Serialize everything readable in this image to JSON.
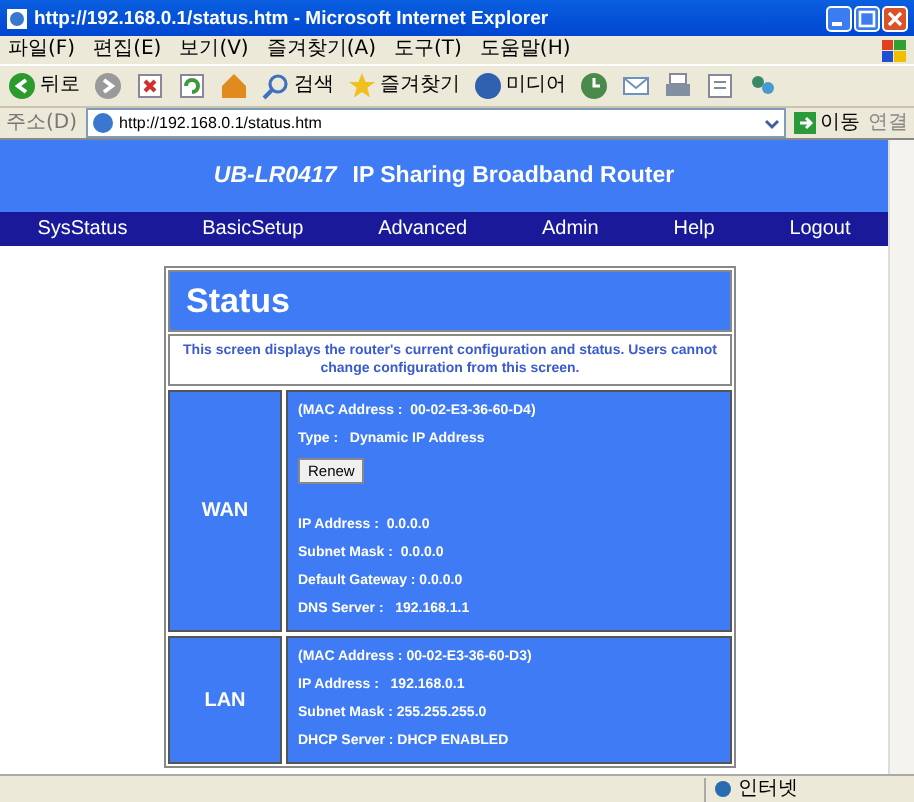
{
  "window": {
    "title": "http://192.168.0.1/status.htm - Microsoft Internet Explorer"
  },
  "menu": [
    "파일(F)",
    "편집(E)",
    "보기(V)",
    "즐겨찾기(A)",
    "도구(T)",
    "도움말(H)"
  ],
  "toolbar": [
    {
      "kind": "back",
      "label": "뒤로"
    },
    {
      "kind": "forward"
    },
    {
      "kind": "stop"
    },
    {
      "kind": "refresh"
    },
    {
      "kind": "home"
    },
    {
      "kind": "search",
      "label": "검색"
    },
    {
      "kind": "favorites",
      "label": "즐겨찾기"
    },
    {
      "kind": "media",
      "label": "미디어"
    },
    {
      "kind": "history"
    },
    {
      "kind": "mail"
    },
    {
      "kind": "print"
    },
    {
      "kind": "edit"
    },
    {
      "kind": "messenger"
    }
  ],
  "address": {
    "label": "주소(D)",
    "value": "http://192.168.0.1/status.htm",
    "go": "이동",
    "links": "연결"
  },
  "header": {
    "model": "UB-LR0417",
    "title": "IP Sharing Broadband Router"
  },
  "nav": [
    "SysStatus",
    "BasicSetup",
    "Advanced",
    "Admin",
    "Help",
    "Logout"
  ],
  "panel": {
    "title": "Status",
    "description": "This screen displays the router's current configuration and status. Users cannot change configuration from this screen.",
    "sections": [
      {
        "name": "WAN",
        "items": [
          {
            "kind": "text",
            "text": "(MAC Address :  00-02-E3-36-60-D4)"
          },
          {
            "kind": "text",
            "text": "Type :   Dynamic IP Address"
          },
          {
            "kind": "button",
            "text": "Renew"
          },
          {
            "kind": "text",
            "text": "IP Address :  0.0.0.0"
          },
          {
            "kind": "text",
            "text": "Subnet Mask :  0.0.0.0"
          },
          {
            "kind": "text",
            "text": "Default Gateway : 0.0.0.0"
          },
          {
            "kind": "text",
            "text": "DNS Server :   192.168.1.1"
          }
        ]
      },
      {
        "name": "LAN",
        "items": [
          {
            "kind": "text",
            "text": "(MAC Address : 00-02-E3-36-60-D3)"
          },
          {
            "kind": "text",
            "text": "IP Address :   192.168.0.1"
          },
          {
            "kind": "text",
            "text": "Subnet Mask : 255.255.255.0"
          },
          {
            "kind": "text",
            "text": "DHCP Server : DHCP ENABLED"
          }
        ]
      }
    ]
  },
  "status_bar": {
    "zone": "인터넷"
  }
}
